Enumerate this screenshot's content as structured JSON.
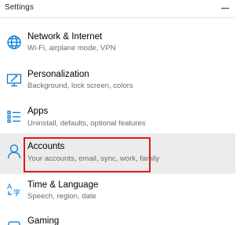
{
  "window": {
    "title": "Settings"
  },
  "accent_color": "#0078d7",
  "highlight_color": "#e01a1a",
  "items": [
    {
      "icon": "globe-icon",
      "name": "Network & Internet",
      "desc": "Wi-Fi, airplane mode, VPN",
      "selected": false
    },
    {
      "icon": "personalization-icon",
      "name": "Personalization",
      "desc": "Background, lock screen, colors",
      "selected": false
    },
    {
      "icon": "apps-list-icon",
      "name": "Apps",
      "desc": "Uninstall, defaults, optional features",
      "selected": false
    },
    {
      "icon": "person-icon",
      "name": "Accounts",
      "desc": "Your accounts, email, sync, work, family",
      "selected": true
    },
    {
      "icon": "time-language-icon",
      "name": "Time & Language",
      "desc": "Speech, region, date",
      "selected": false
    },
    {
      "icon": "gaming-icon",
      "name": "Gaming",
      "desc": "",
      "selected": false
    }
  ]
}
